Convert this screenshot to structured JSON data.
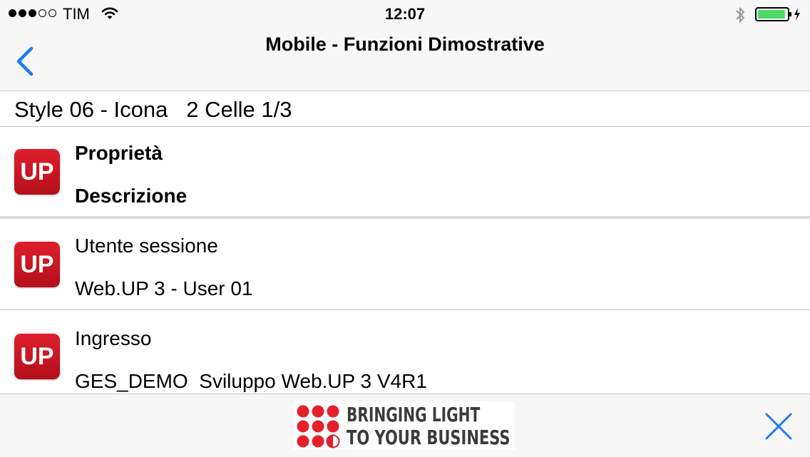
{
  "status_bar": {
    "carrier": "TIM",
    "time": "12:07",
    "signal_bars_filled": 3,
    "signal_bars_total": 5,
    "battery_level": 0.9,
    "icons": [
      "wifi-icon",
      "bluetooth-icon",
      "battery-charging-icon"
    ]
  },
  "nav": {
    "title": "Mobile - Funzioni Dimostrative",
    "back_icon": "chevron-left-icon"
  },
  "section": {
    "title": "Style 06 - Icona   2 Celle 1/3"
  },
  "rows": [
    {
      "icon_text": "UP",
      "line1": "Proprietà",
      "line2": "Descrizione"
    },
    {
      "icon_text": "UP",
      "line1": "Utente sessione",
      "line2": "Web.UP 3 - User 01"
    },
    {
      "icon_text": "UP",
      "line1": "Ingresso",
      "line2": "GES_DEMO  Sviluppo Web.UP 3 V4R1"
    }
  ],
  "ad": {
    "line1": "BRINGING LIGHT",
    "line2": "TO YOUR BUSINESS",
    "close_icon": "close-icon"
  },
  "colors": {
    "accent": "#1a7cf5",
    "brand_red": "#d0202e",
    "bar_background": "#f7f7f7",
    "battery_green": "#4cd964"
  }
}
